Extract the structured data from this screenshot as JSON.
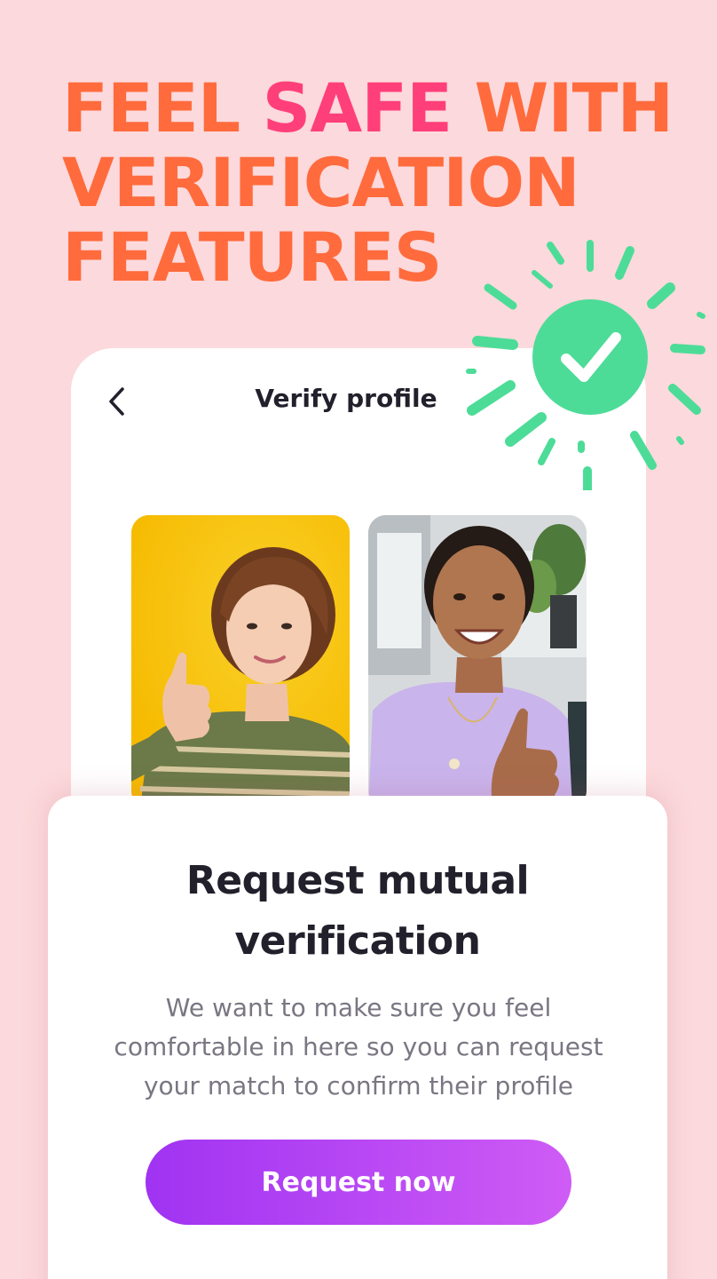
{
  "headline": {
    "line1_part1": "FEEL ",
    "line1_accent": "SAFE",
    "line1_part2": " WITH",
    "line2": "VERIFICATION",
    "line3": "FEATURES"
  },
  "screen": {
    "title": "Verify profile",
    "back_icon": "chevron-left-icon"
  },
  "badge": {
    "icon": "checkmark-icon",
    "color": "#4ddc98"
  },
  "photos": [
    {
      "name": "profile-photo-woman-yellow-background"
    },
    {
      "name": "selfie-photo-woman-thumbs-up"
    }
  ],
  "sheet": {
    "title_line1": "Request mutual",
    "title_line2": "verification",
    "body_line1": "We want to make sure you feel",
    "body_line2": "comfortable in here so you can request",
    "body_line3": "your match to confirm their profile",
    "cta_label": "Request now"
  },
  "colors": {
    "background": "#fcd9dc",
    "headline": "#ff6b3d",
    "headline_accent": "#ff3f7a",
    "cta_start": "#a033f2",
    "cta_end": "#cf5cf5"
  }
}
